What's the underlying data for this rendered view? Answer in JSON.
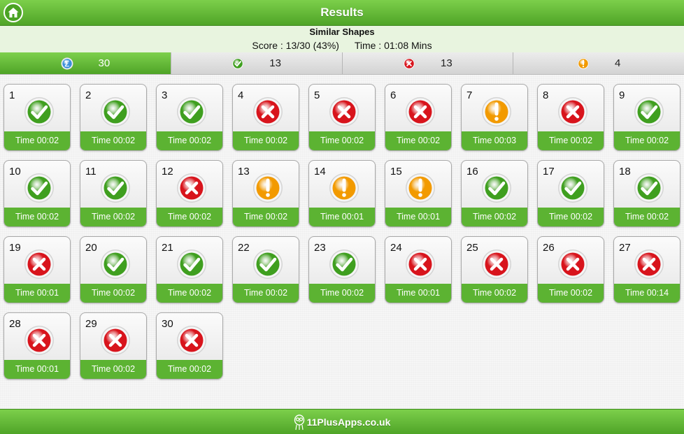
{
  "header": {
    "title": "Results"
  },
  "info": {
    "subtitle": "Similar Shapes",
    "score": "Score : 13/30 (43%)",
    "time": "Time : 01:08 Mins"
  },
  "tabs": [
    {
      "icon": "sum-icon",
      "count": "30",
      "active": true
    },
    {
      "icon": "check-icon",
      "count": "13",
      "active": false
    },
    {
      "icon": "cross-icon",
      "count": "13",
      "active": false
    },
    {
      "icon": "exclamation-icon",
      "count": "4",
      "active": false
    }
  ],
  "questions": [
    {
      "num": "1",
      "status": "correct",
      "time": "Time 00:02"
    },
    {
      "num": "2",
      "status": "correct",
      "time": "Time 00:02"
    },
    {
      "num": "3",
      "status": "correct",
      "time": "Time 00:02"
    },
    {
      "num": "4",
      "status": "wrong",
      "time": "Time 00:02"
    },
    {
      "num": "5",
      "status": "wrong",
      "time": "Time 00:02"
    },
    {
      "num": "6",
      "status": "wrong",
      "time": "Time 00:02"
    },
    {
      "num": "7",
      "status": "skipped",
      "time": "Time 00:03"
    },
    {
      "num": "8",
      "status": "wrong",
      "time": "Time 00:02"
    },
    {
      "num": "9",
      "status": "correct",
      "time": "Time 00:02"
    },
    {
      "num": "10",
      "status": "correct",
      "time": "Time 00:02"
    },
    {
      "num": "11",
      "status": "correct",
      "time": "Time 00:02"
    },
    {
      "num": "12",
      "status": "wrong",
      "time": "Time 00:02"
    },
    {
      "num": "13",
      "status": "skipped",
      "time": "Time 00:02"
    },
    {
      "num": "14",
      "status": "skipped",
      "time": "Time 00:01"
    },
    {
      "num": "15",
      "status": "skipped",
      "time": "Time 00:01"
    },
    {
      "num": "16",
      "status": "correct",
      "time": "Time 00:02"
    },
    {
      "num": "17",
      "status": "correct",
      "time": "Time 00:02"
    },
    {
      "num": "18",
      "status": "correct",
      "time": "Time 00:02"
    },
    {
      "num": "19",
      "status": "wrong",
      "time": "Time 00:01"
    },
    {
      "num": "20",
      "status": "correct",
      "time": "Time 00:02"
    },
    {
      "num": "21",
      "status": "correct",
      "time": "Time 00:02"
    },
    {
      "num": "22",
      "status": "correct",
      "time": "Time 00:02"
    },
    {
      "num": "23",
      "status": "correct",
      "time": "Time 00:02"
    },
    {
      "num": "24",
      "status": "wrong",
      "time": "Time 00:01"
    },
    {
      "num": "25",
      "status": "wrong",
      "time": "Time 00:02"
    },
    {
      "num": "26",
      "status": "wrong",
      "time": "Time 00:02"
    },
    {
      "num": "27",
      "status": "wrong",
      "time": "Time 00:14"
    },
    {
      "num": "28",
      "status": "wrong",
      "time": "Time 00:01"
    },
    {
      "num": "29",
      "status": "wrong",
      "time": "Time 00:02"
    },
    {
      "num": "30",
      "status": "wrong",
      "time": "Time 00:02"
    }
  ],
  "footer": {
    "brand": "11PlusApps.co.uk",
    "logo_icon": "owl-logo-icon"
  },
  "colors": {
    "brand_green": "#5cb332",
    "correct": "#3f9f1f",
    "wrong": "#d8141c",
    "skipped": "#f29a00",
    "sum": "#3a8fd9"
  }
}
